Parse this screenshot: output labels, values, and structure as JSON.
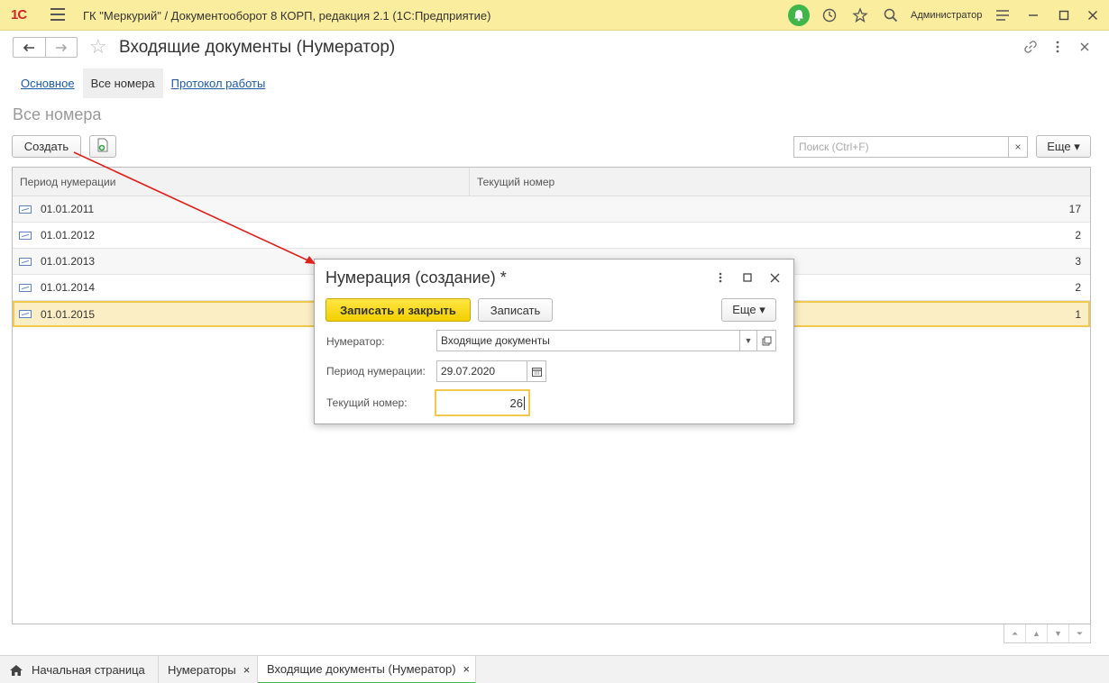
{
  "app": {
    "logo": "1С",
    "title": "ГК \"Меркурий\" / Документооборот 8 КОРП, редакция 2.1  (1С:Предприятие)",
    "user": "Администратор"
  },
  "form": {
    "title": "Входящие документы (Нумератор)",
    "tabs": [
      "Основное",
      "Все номера",
      "Протокол работы"
    ],
    "active_tab": "Все номера",
    "section_title": "Все номера"
  },
  "toolbar": {
    "create_label": "Создать",
    "search_placeholder": "Поиск (Ctrl+F)",
    "search_clear": "×",
    "more_label": "Еще ▾"
  },
  "table": {
    "columns": [
      "Период нумерации",
      "Текущий номер"
    ],
    "rows": [
      {
        "period": "01.01.2011",
        "number": "17"
      },
      {
        "period": "01.01.2012",
        "number": "2"
      },
      {
        "period": "01.01.2013",
        "number": "3"
      },
      {
        "period": "01.01.2014",
        "number": "2"
      },
      {
        "period": "01.01.2015",
        "number": "1"
      }
    ],
    "selected_index": 4
  },
  "taskbar": {
    "home": "Начальная страница",
    "tab2": "Нумераторы",
    "tab3": "Входящие документы (Нумератор)",
    "close": "×"
  },
  "dialog": {
    "title": "Нумерация (создание) *",
    "save_close_label": "Записать и закрыть",
    "save_label": "Записать",
    "more_label": "Еще ▾",
    "fields": {
      "numerator_label": "Нумератор:",
      "numerator_value": "Входящие документы",
      "period_label": "Период нумерации:",
      "period_value": "29.07.2020",
      "current_label": "Текущий номер:",
      "current_value": "26"
    }
  },
  "colors": {
    "titlebar": "#fbed9e",
    "accent_yellow": "#f3d000",
    "selection": "#fbeec4",
    "link": "#1f5aa5",
    "annotation_arrow": "#e0201a"
  }
}
